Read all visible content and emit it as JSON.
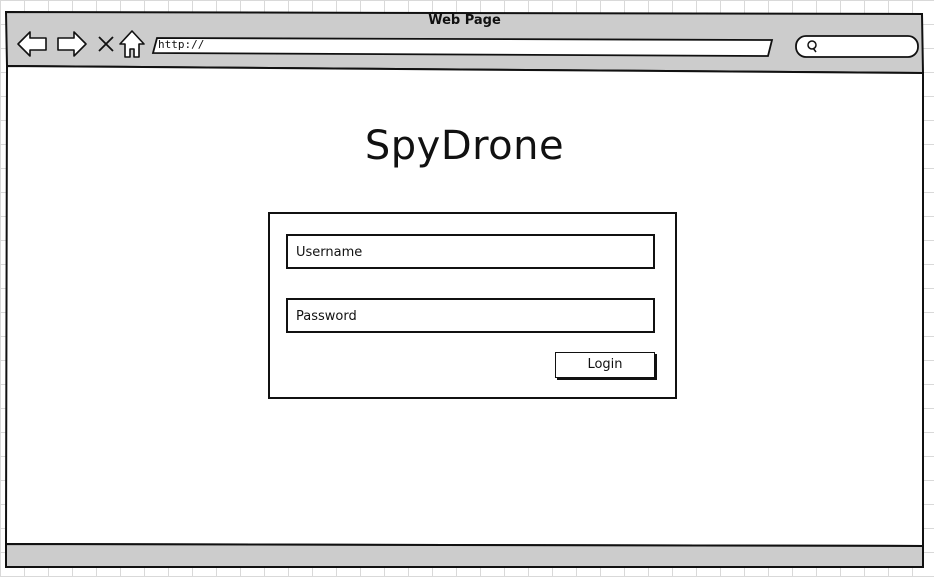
{
  "window": {
    "title": "Web Page"
  },
  "toolbar": {
    "url": "http://",
    "icons": [
      "back-icon",
      "forward-icon",
      "stop-icon",
      "home-icon",
      "search-icon"
    ]
  },
  "app": {
    "title": "SpyDrone"
  },
  "login": {
    "username_label": "Username",
    "password_label": "Password",
    "button_label": "Login"
  },
  "colors": {
    "chrome": "#cccccc",
    "stroke": "#111111",
    "page": "#ffffff"
  }
}
